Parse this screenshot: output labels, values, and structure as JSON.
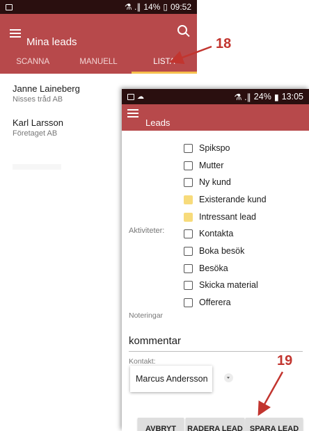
{
  "back_screen": {
    "status": {
      "right": "⚗ .∥ 14% ▯ 09:52",
      "battery": "14%",
      "time": "09:52"
    },
    "app_title": "Mina leads",
    "tabs": [
      {
        "label": "SCANNA",
        "active": false
      },
      {
        "label": "MANUELL",
        "active": false
      },
      {
        "label": "LISTA",
        "active": true
      }
    ],
    "leads": [
      {
        "name": "Janne Laineberg",
        "company": "Nisses tråd AB"
      },
      {
        "name": "Karl Larsson",
        "company": "Företaget AB"
      }
    ]
  },
  "front_screen": {
    "status": {
      "battery": "24%",
      "time": "13:05"
    },
    "app_title": "Leads",
    "activities_label": "Aktiviteter:",
    "activities": [
      {
        "label": "Spikspo",
        "checked": false
      },
      {
        "label": "Mutter",
        "checked": false
      },
      {
        "label": "Ny kund",
        "checked": false
      },
      {
        "label": "Existerande kund",
        "checked": true
      },
      {
        "label": "Intressant lead",
        "checked": true
      },
      {
        "label": "Kontakta",
        "checked": false
      },
      {
        "label": "Boka besök",
        "checked": false
      },
      {
        "label": "Besöka",
        "checked": false
      },
      {
        "label": "Skicka material",
        "checked": false
      },
      {
        "label": "Offerera",
        "checked": false
      }
    ],
    "notes_label": "Noteringar",
    "notes_value": "kommentar",
    "contact_label": "Kontakt:",
    "contact_value": "Marcus Andersson",
    "buttons": {
      "cancel": "AVBRYT",
      "delete": "RADERA LEAD",
      "save": "SPARA LEAD"
    }
  },
  "annotations": {
    "step_18": "18",
    "step_19": "19"
  },
  "colors": {
    "appbar": "#b7494b",
    "status_bar": "#2a0f0f",
    "tab_indicator": "#f6c04d",
    "checked": "#f7db7b",
    "annotation": "#c2352f"
  }
}
